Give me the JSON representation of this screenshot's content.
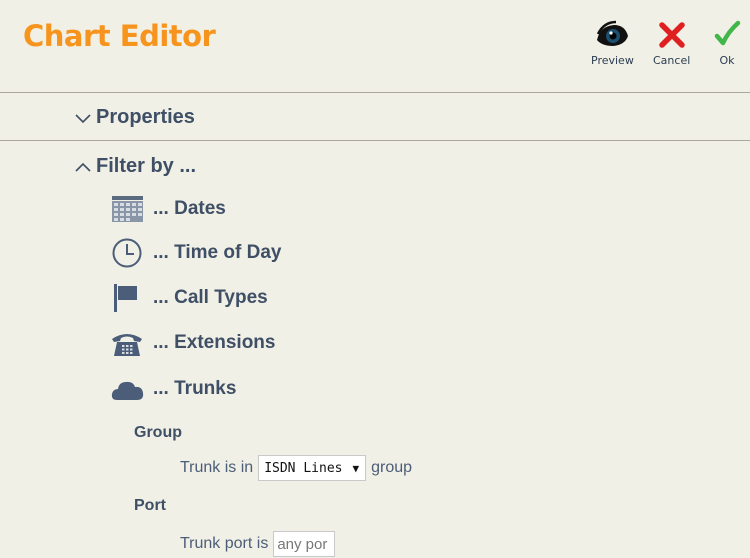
{
  "header": {
    "title": "Chart Editor",
    "actions": [
      {
        "label": "Preview",
        "icon": "eye-icon"
      },
      {
        "label": "Cancel",
        "icon": "close-icon",
        "color": "#e02020"
      },
      {
        "label": "Ok",
        "icon": "checkmark-icon",
        "color": "#41b649"
      }
    ]
  },
  "colors": {
    "title": "#f7941d",
    "text": "#3e4f66",
    "background": "#f1f0e6"
  },
  "sections": {
    "properties": {
      "label": "Properties",
      "state": "collapsed",
      "icon": "chevron-down-icon"
    },
    "filter": {
      "label": "Filter by ...",
      "state": "expanded",
      "icon": "chevron-up-icon"
    }
  },
  "filters": [
    {
      "label": "... Dates",
      "icon": "calendar-icon"
    },
    {
      "label": "... Time of Day",
      "icon": "clock-icon"
    },
    {
      "label": "... Call Types",
      "icon": "flag-icon"
    },
    {
      "label": "... Extensions",
      "icon": "telephone-icon"
    },
    {
      "label": "... Trunks",
      "icon": "cloud-icon"
    }
  ],
  "trunks": {
    "group": {
      "label": "Group",
      "prefix": "Trunk is in",
      "selected": "ISDN Lines",
      "suffix": "group"
    },
    "port": {
      "label": "Port",
      "prefix": "Trunk port is",
      "value": "any por"
    }
  }
}
